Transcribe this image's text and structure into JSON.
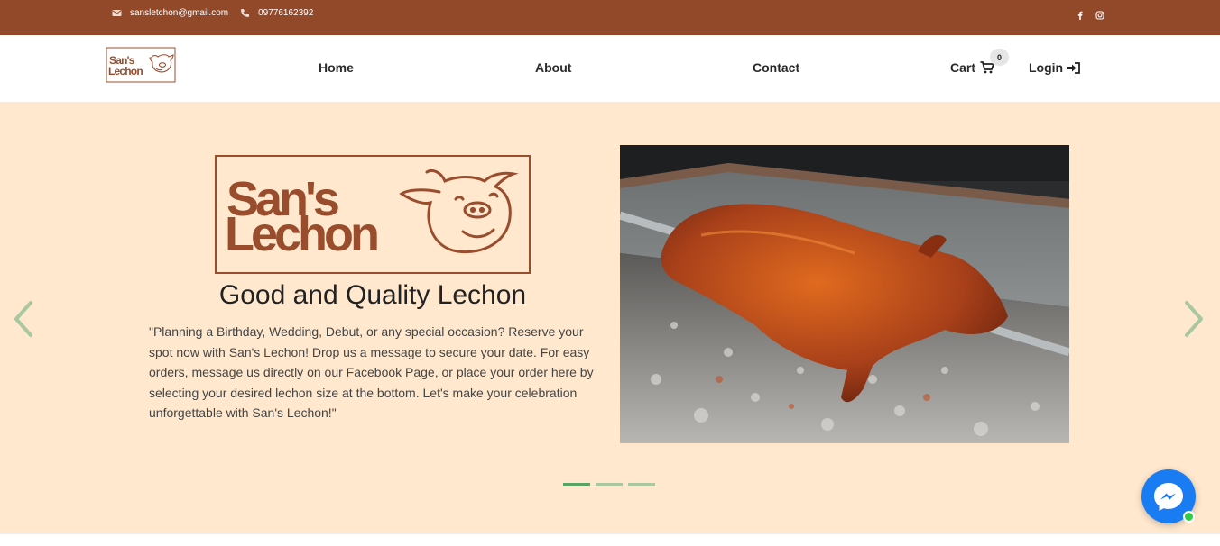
{
  "topbar": {
    "email": "sansletchon@gmail.com",
    "phone": "09776162392",
    "email_icon": "envelope-icon",
    "phone_icon": "phone-icon",
    "social": [
      "facebook-icon",
      "instagram-icon"
    ],
    "bg_color": "#92492a"
  },
  "nav": {
    "logo_text_1": "San's",
    "logo_text_2": "Lechon",
    "home": "Home",
    "about": "About",
    "contact": "Contact",
    "cart": "Cart",
    "cart_count": "0",
    "login": "Login"
  },
  "hero": {
    "logo_text_1": "San's",
    "logo_text_2": "Lechon",
    "title": "Good and Quality Lechon",
    "description": "\"Planning a Birthday, Wedding, Debut, or any special occasion? Reserve your spot now with San's Lechon! Drop us a message to secure your date. For easy orders, message us directly on our Facebook Page, or place your order here by selecting your desired lechon size at the bottom. Let's make your celebration unforgettable with San's Lechon!\"",
    "slides_total": 3,
    "active_slide": 1,
    "bg_color": "#ffe8ce",
    "brand_color": "#9a4d2d"
  },
  "chat": {
    "icon": "messenger-icon",
    "status": "online"
  }
}
